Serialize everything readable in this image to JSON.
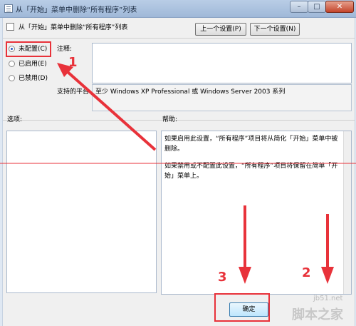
{
  "window": {
    "title": "从「开始」菜单中删除“所有程序”列表",
    "controls": {
      "minimize": "–",
      "maximize": "□",
      "close": "✕"
    }
  },
  "header": {
    "setting_title": "从「开始」菜单中删除“所有程序”列表",
    "prev_button": "上一个设置(P)",
    "next_button": "下一个设置(N)"
  },
  "state": {
    "options": [
      {
        "label": "未配置(C)",
        "selected": true
      },
      {
        "label": "已启用(E)",
        "selected": false
      },
      {
        "label": "已禁用(D)",
        "selected": false
      }
    ]
  },
  "comment": {
    "label": "注释:",
    "value": ""
  },
  "support": {
    "label": "支持的平台:",
    "value": "至少 Windows XP Professional 或 Windows Server 2003 系列"
  },
  "options_panel": {
    "label": "选项:"
  },
  "help_panel": {
    "label": "帮助:",
    "paragraphs": [
      "如果启用此设置，“所有程序”项目将从简化「开始」菜单中被删除。",
      "如果禁用或不配置此设置，“所有程序”项目将保留在简单「开始」菜单上。"
    ]
  },
  "footer": {
    "ok_button": "确定"
  },
  "annotations": {
    "step1": "1",
    "step2": "2",
    "step3": "3",
    "color": "#e8323a"
  },
  "watermark": {
    "url": "jb51.net",
    "text": "脚本之家"
  }
}
